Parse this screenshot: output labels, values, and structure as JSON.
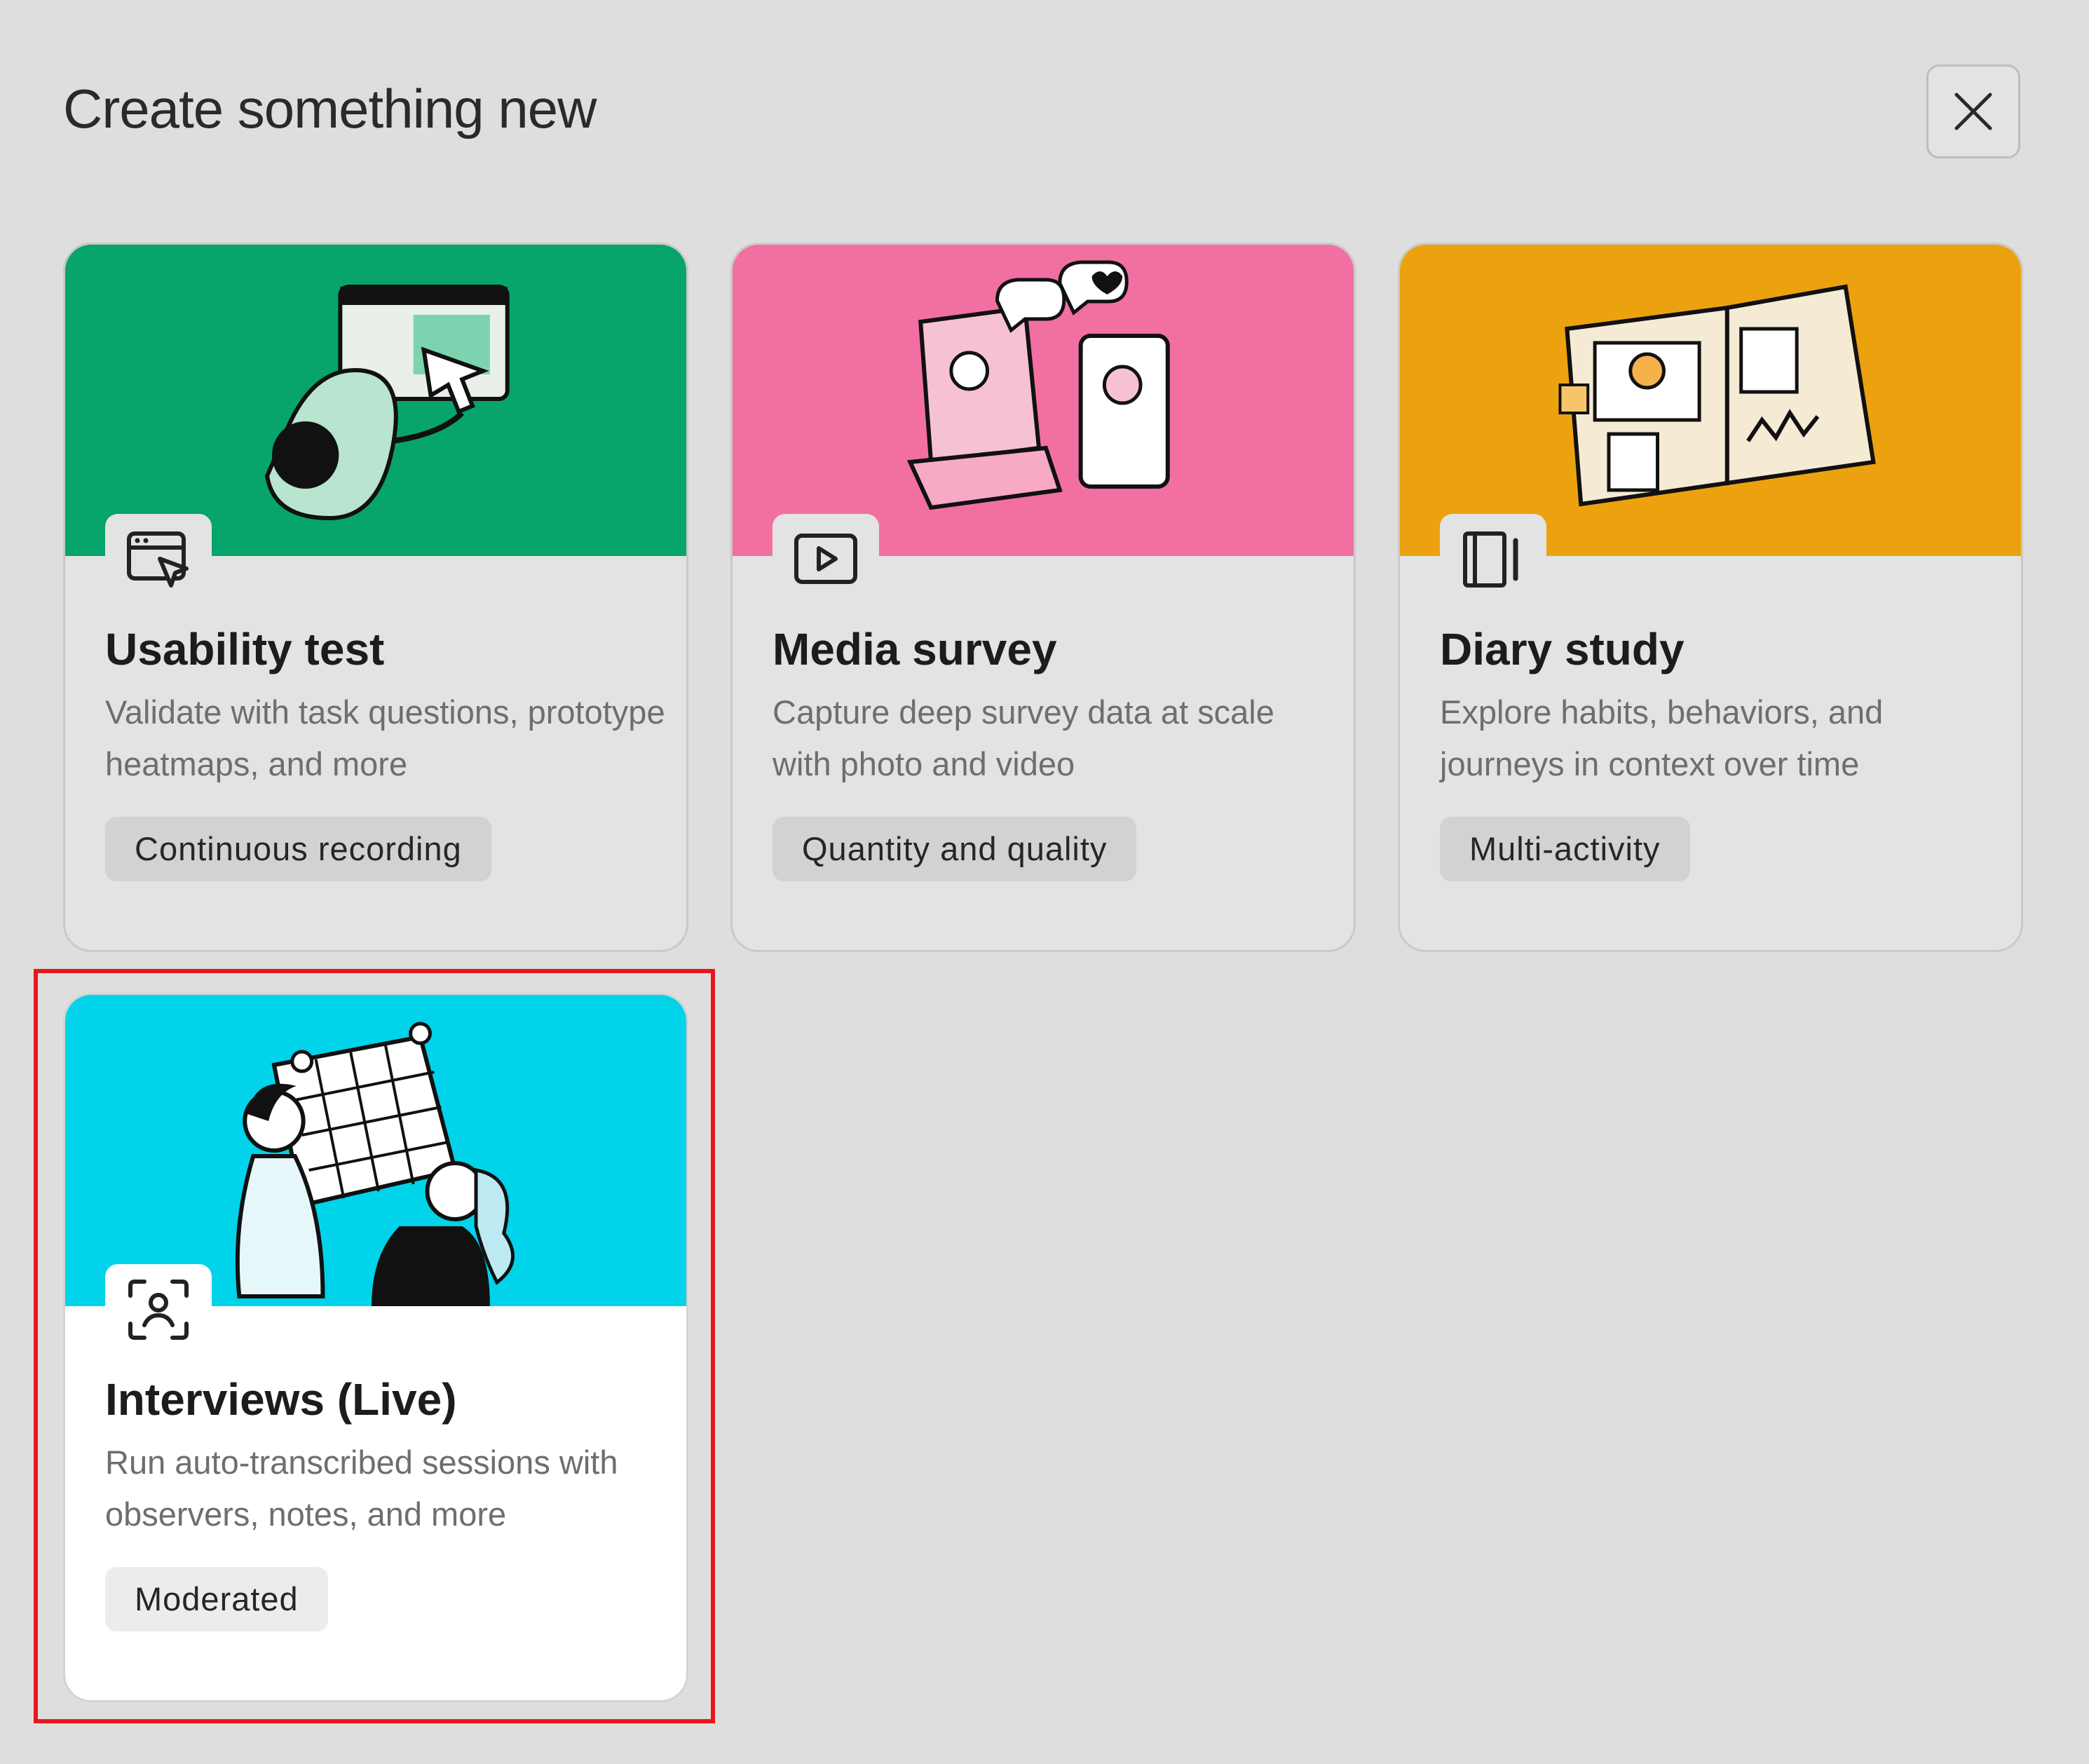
{
  "header": {
    "title": "Create something new",
    "close_icon": "close-icon"
  },
  "cards": [
    {
      "title": "Usability test",
      "description": "Validate with task questions, prototype heatmaps, and more",
      "tag": "Continuous recording",
      "icon": "browser-cursor-icon",
      "hero_color": "#07a46c"
    },
    {
      "title": "Media survey",
      "description": "Capture deep survey data at scale with photo and video",
      "tag": "Quantity and quality",
      "icon": "play-icon",
      "hero_color": "#f270a1"
    },
    {
      "title": "Diary study",
      "description": "Explore habits, behaviors, and journeys in context over time",
      "tag": "Multi-activity",
      "icon": "notebook-icon",
      "hero_color": "#eca20f"
    },
    {
      "title": "Interviews (Live)",
      "description": "Run auto-transcribed sessions with observers, notes, and more",
      "tag": "Moderated",
      "icon": "person-focus-icon",
      "hero_color": "#00d3ea",
      "selected": true
    }
  ]
}
